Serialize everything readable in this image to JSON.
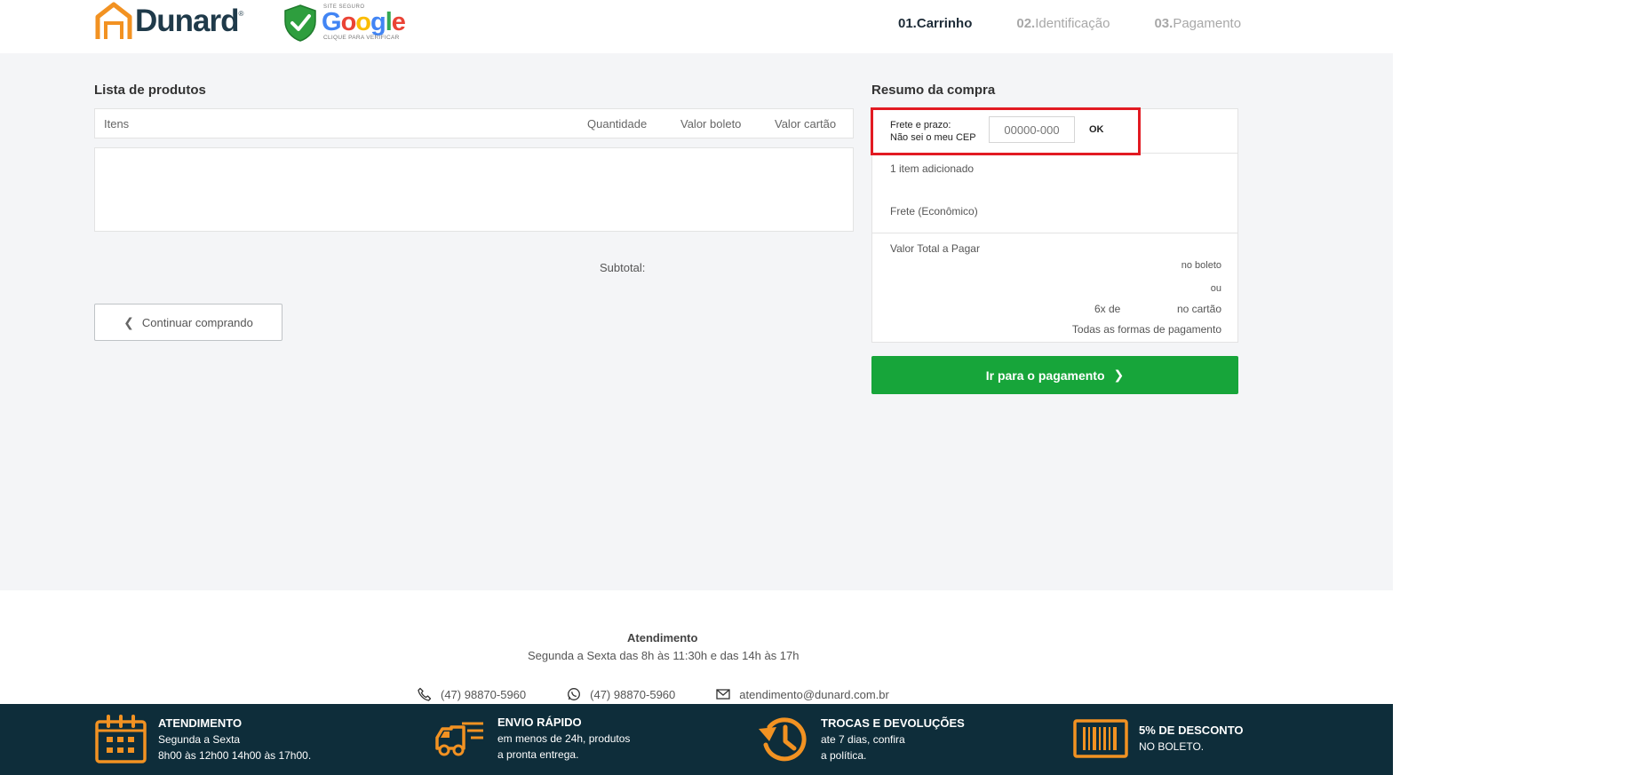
{
  "brand": {
    "name": "Dunard",
    "reg": "®",
    "badge_top": "SITE SEGURO",
    "badge_word": "Google",
    "badge_bottom": "CLIQUE PARA VERIFICAR"
  },
  "steps": [
    {
      "num": "01.",
      "label": "Carrinho"
    },
    {
      "num": "02.",
      "label": "Identificação"
    },
    {
      "num": "03.",
      "label": "Pagamento"
    }
  ],
  "products": {
    "title": "Lista de produtos",
    "columns": {
      "items": "Itens",
      "quantity": "Quantidade",
      "boleto": "Valor boleto",
      "card": "Valor cartão"
    },
    "subtotal_label": "Subtotal:",
    "continue_label": "Continuar comprando"
  },
  "summary": {
    "title": "Resumo da compra",
    "frete_label": "Frete e prazo:",
    "cep_link": "Não sei o meu CEP",
    "cep_placeholder": "00000-000",
    "ok_label": "OK",
    "items_added": "1 item adicionado",
    "frete_type": "Frete (Econômico)",
    "total_label": "Valor Total a Pagar",
    "no_boleto": "no boleto",
    "ou": "ou",
    "installments": "6x de",
    "no_cartao": "no cartão",
    "all_payments": "Todas as formas de pagamento",
    "pay_button": "Ir para o pagamento"
  },
  "footer": {
    "atendimento_title": "Atendimento",
    "atendimento_hours": "Segunda a Sexta das 8h às 11:30h e das 14h às 17h",
    "phone": "(47) 98870-5960",
    "whatsapp": "(47) 98870-5960",
    "email": "atendimento@dunard.com.br",
    "features": [
      {
        "title": "ATENDIMENTO",
        "line1": "Segunda a Sexta",
        "line2": "8h00 às 12h00 14h00 às 17h00."
      },
      {
        "title": "ENVIO RÁPIDO",
        "line1": "em menos de 24h, produtos",
        "line2": "a pronta entrega."
      },
      {
        "title": "TROCAS E DEVOLUÇÕES",
        "line1": "ate 7 dias, confira",
        "line2": "a política."
      },
      {
        "title": "5% DE DESCONTO",
        "line1": "NO BOLETO."
      }
    ]
  },
  "colors": {
    "accent_orange": "#f29222",
    "primary_dark": "#1f3a4a",
    "pay_green": "#17a53a",
    "highlight_red": "#e21a22",
    "footer_bar": "#0e2d3a"
  }
}
